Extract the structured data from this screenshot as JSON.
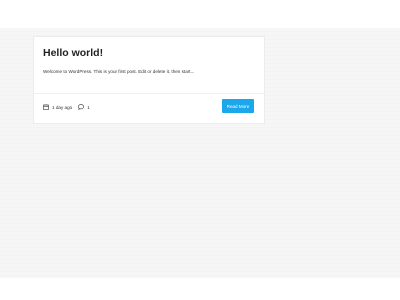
{
  "post": {
    "title": "Hello world!",
    "excerpt": "Welcome to WordPress. This is your first post. Edit or delete it, then start...",
    "date_label": "1 day ago",
    "comment_count": "1",
    "read_more_label": "Read More"
  },
  "icons": {
    "date": "calendar-icon",
    "comments": "comment-icon"
  },
  "colors": {
    "accent": "#1aa7ec",
    "page_background": "#f6f6f6",
    "card_background": "#ffffff",
    "text": "#222222"
  }
}
